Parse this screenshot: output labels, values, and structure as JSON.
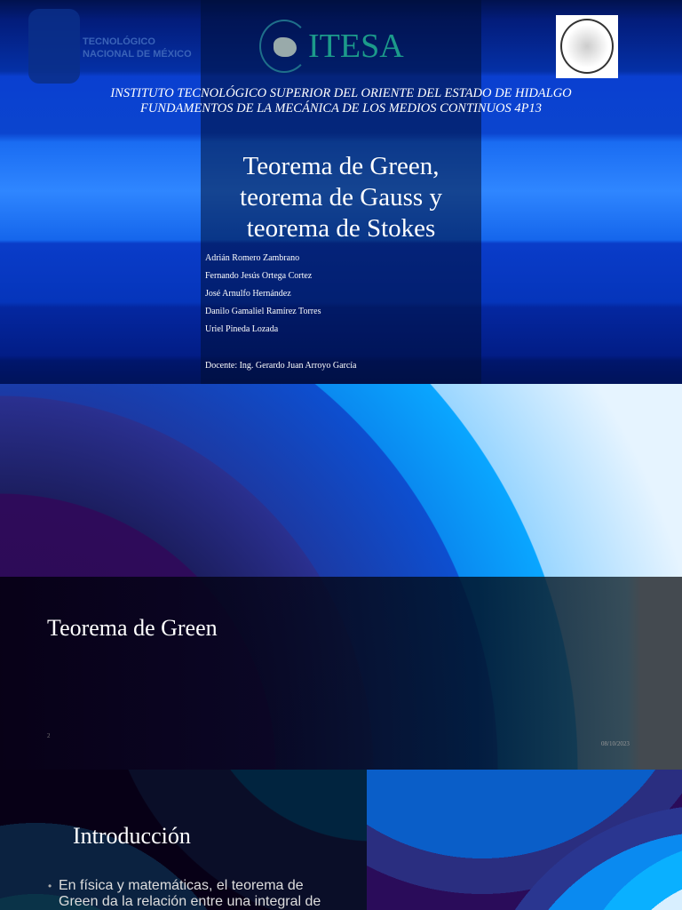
{
  "slide1": {
    "logo_tec_text": [
      "TECNOLÓGICO",
      "NACIONAL DE MÉXICO"
    ],
    "logo_itesa": "ITESA",
    "institute": "INSTITUTO TECNOLÓGICO SUPERIOR DEL ORIENTE DEL ESTADO DE HIDALGO",
    "course": "FUNDAMENTOS DE LA MECÁNICA DE LOS MEDIOS CONTINUOS 4P13",
    "title_lines": [
      "Teorema de Green,",
      "teorema de Gauss y",
      "teorema de Stokes"
    ],
    "authors": [
      "Adrián Romero Zambrano",
      "Fernando Jesús Ortega Cortez",
      "José Arnulfo Hernández",
      "Danilo Gamaliel Ramírez Torres",
      "Uriel Pineda Lozada"
    ],
    "teacher": "Docente: Ing. Gerardo Juan Arroyo García"
  },
  "slide2": {
    "title": "Teorema de Green",
    "page_number": "2",
    "date": "08/10/2023"
  },
  "slide3": {
    "title": "Introducción",
    "bullet": "En física y matemáticas, el teorema de Green da la relación entre una integral de"
  }
}
